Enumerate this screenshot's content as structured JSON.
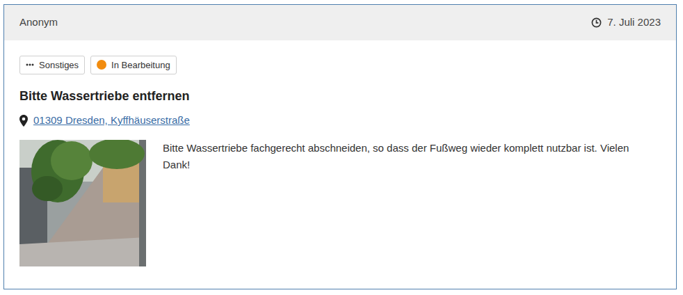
{
  "header": {
    "author": "Anonym",
    "date": "7. Juli 2023"
  },
  "tags": [
    {
      "label": "Sonstiges",
      "kind": "category"
    },
    {
      "label": "In Bearbeitung",
      "kind": "status",
      "color": "#f28c0f"
    }
  ],
  "title": "Bitte Wassertriebe entfernen",
  "location": "01309 Dresden, Kyffhäuserstraße",
  "description": "Bitte Wassertriebe fachgerecht abschneiden, so dass der Fußweg wieder komplett nutzbar ist. Vielen Dank!"
}
